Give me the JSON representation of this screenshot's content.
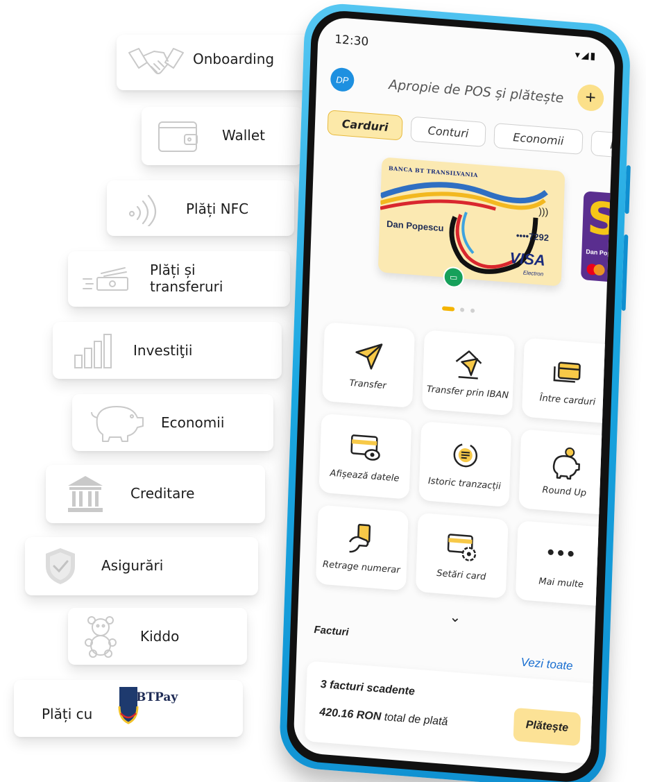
{
  "features": {
    "onboarding": "Onboarding",
    "wallet": "Wallet",
    "nfc": "Plăți NFC",
    "transfers_line1": "Plăți și",
    "transfers_line2": "transferuri",
    "investments": "Investiţii",
    "savings": "Economii",
    "credit": "Creditare",
    "insurance": "Asigurări",
    "kiddo": "Kiddo",
    "btpay_prefix": "Plăți cu",
    "btpay_logo_text": "BTPay"
  },
  "phone": {
    "status_time": "12:30",
    "status_icons": "▾◢▮",
    "avatar_initials": "DP",
    "header_title": "Apropie de POS și plătește",
    "add_label": "+",
    "tabs": [
      "Carduri",
      "Conturi",
      "Economii",
      "Kiddo"
    ],
    "card": {
      "bank": "BANCA BT TRANSILVANIA",
      "holder": "Dan Popescu",
      "number": "••••7292",
      "network": "VISA",
      "network_sub": "Electron",
      "contactless": ")))"
    },
    "next_card": {
      "letter": "S",
      "holder": "Dan Popesc"
    },
    "actions": [
      "Transfer",
      "Transfer prin IBAN",
      "Între carduri",
      "Afișează datele",
      "Istoric tranzacții",
      "Round Up",
      "Retrage numerar",
      "Setări card",
      "Mai multe"
    ],
    "more_dots": "•••",
    "expand_chevron": "⌄",
    "bills": {
      "title": "Facturi",
      "see_all": "Vezi toate",
      "count_text": "3 facturi scadente",
      "amount": "420.16 RON",
      "amount_suffix": "total de plată",
      "pay": "Plătește"
    }
  },
  "colors": {
    "accent_yellow": "#fce296",
    "phone_blue": "#1aa6e0",
    "link_blue": "#1a6fd0",
    "icon_grey": "#c9c9c9"
  }
}
